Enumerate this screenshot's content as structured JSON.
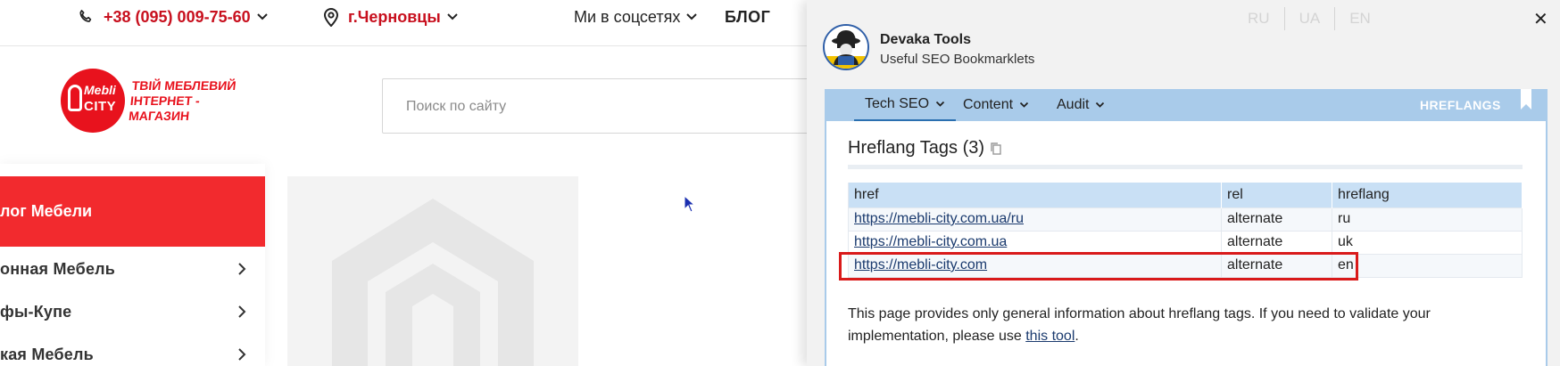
{
  "site": {
    "topbar": {
      "phone": "+38 (095) 009-75-60",
      "city": "г.Черновцы",
      "social": "Ми в соцсетях",
      "blog": "БЛОГ"
    },
    "logo": {
      "mark_word_1": "Mebli",
      "mark_word_2": "CITY",
      "tagline_line_1": "ТВІЙ МЕБЛЕВИЙ",
      "tagline_line_2": "ІНТЕРНЕТ - МАГАЗИН",
      "brand_color": "#e8121d"
    },
    "search": {
      "placeholder": "Поиск по сайту"
    },
    "catalog": {
      "header": "лог Мебели",
      "items": [
        {
          "label": "онная Мебель"
        },
        {
          "label": "фы-Купе"
        },
        {
          "label": "кая Мебель"
        }
      ],
      "accent_color": "#f22a2e"
    }
  },
  "extension": {
    "languages": [
      "RU",
      "UA",
      "EN"
    ],
    "brand": {
      "title": "Devaka Tools",
      "subtitle": "Useful SEO Bookmarklets"
    },
    "nav": {
      "tabs": [
        {
          "label": "Tech SEO",
          "active": true
        },
        {
          "label": "Content",
          "active": false
        },
        {
          "label": "Audit",
          "active": false
        }
      ],
      "right_label": "HREFLANGS",
      "bar_color": "#a9cbea"
    },
    "section": {
      "title": "Hreflang Tags (3)",
      "columns": [
        "href",
        "rel",
        "hreflang"
      ],
      "rows": [
        {
          "href": "https://mebli-city.com.ua/ru",
          "rel": "alternate",
          "hreflang": "ru"
        },
        {
          "href": "https://mebli-city.com.ua",
          "rel": "alternate",
          "hreflang": "uk"
        },
        {
          "href": "https://mebli-city.com",
          "rel": "alternate",
          "hreflang": "en"
        }
      ],
      "highlight_color": "#d91a1a"
    },
    "info": {
      "text_before": "This page provides only general information about hreflang tags. If you need to validate your implementation, please use ",
      "link_text": "this tool",
      "text_after": "."
    }
  }
}
